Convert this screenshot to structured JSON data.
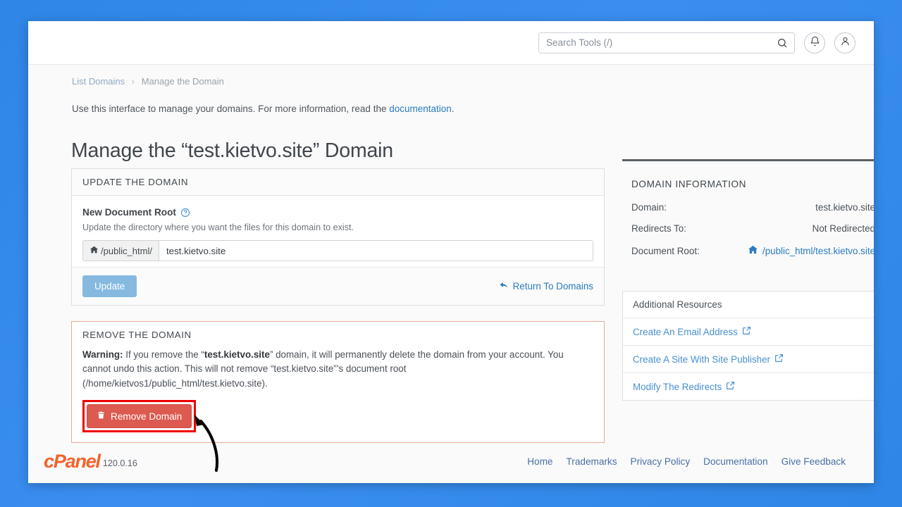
{
  "header": {
    "search_placeholder": "Search Tools (/)",
    "search_value": "",
    "search_icon": "search-icon",
    "notifications_icon": "bell-icon",
    "account_icon": "user-icon"
  },
  "breadcrumb": {
    "root": "List Domains",
    "separator": "›",
    "current": "Manage the Domain"
  },
  "intro": {
    "text_before": "Use this interface to manage your domains. For more information, read the ",
    "link": "documentation",
    "text_after": "."
  },
  "page_title": "Manage the “test.kietvo.site” Domain",
  "update_panel": {
    "heading": "UPDATE THE DOMAIN",
    "field_label": "New Document Root",
    "help_icon": "question-circle-icon",
    "hint": "Update the directory where you want the files for this domain to exist.",
    "input_addon": "/public_html/",
    "addon_icon": "home-icon",
    "input_value": "test.kietvo.site",
    "update_label": "Update",
    "return_label": "Return To Domains",
    "return_icon": "arrow-back-icon"
  },
  "remove_panel": {
    "heading": "REMOVE THE DOMAIN",
    "warning_label": "Warning:",
    "warning_part1": " If you remove the “",
    "warning_domain": "test.kietvo.site",
    "warning_part2": "” domain, it will permanently delete the domain from your account. You cannot undo this action. This will not remove “test.kietvo.site”’s document root (/home/kietvos1/public_html/test.kietvo.site).",
    "remove_label": "Remove Domain",
    "remove_icon": "trash-icon",
    "highlight_color": "#ee0000"
  },
  "sidebar": {
    "info_heading": "DOMAIN INFORMATION",
    "rows": [
      {
        "label": "Domain:",
        "value": "test.kietvo.site",
        "is_link": false
      },
      {
        "label": "Redirects To:",
        "value": "Not Redirected",
        "is_link": false
      },
      {
        "label": "Document Root:",
        "value": "/public_html/test.kietvo.site",
        "is_link": true,
        "icon": "home-icon"
      }
    ],
    "resources_heading": "Additional Resources",
    "resources": [
      {
        "label": "Create An Email Address",
        "icon": "external-link-icon"
      },
      {
        "label": "Create A Site With Site Publisher",
        "icon": "external-link-icon"
      },
      {
        "label": "Modify The Redirects",
        "icon": "external-link-icon"
      }
    ]
  },
  "footer": {
    "logo_text": "cPanel",
    "version": "120.0.16",
    "links": [
      "Home",
      "Trademarks",
      "Privacy Policy",
      "Documentation",
      "Give Feedback"
    ]
  },
  "colors": {
    "page_background": "#2f86e6",
    "brand_orange": "#f6622d",
    "link_blue": "#2a7bbf",
    "danger_red": "#dd5a51",
    "update_blue": "#85b9e0"
  }
}
